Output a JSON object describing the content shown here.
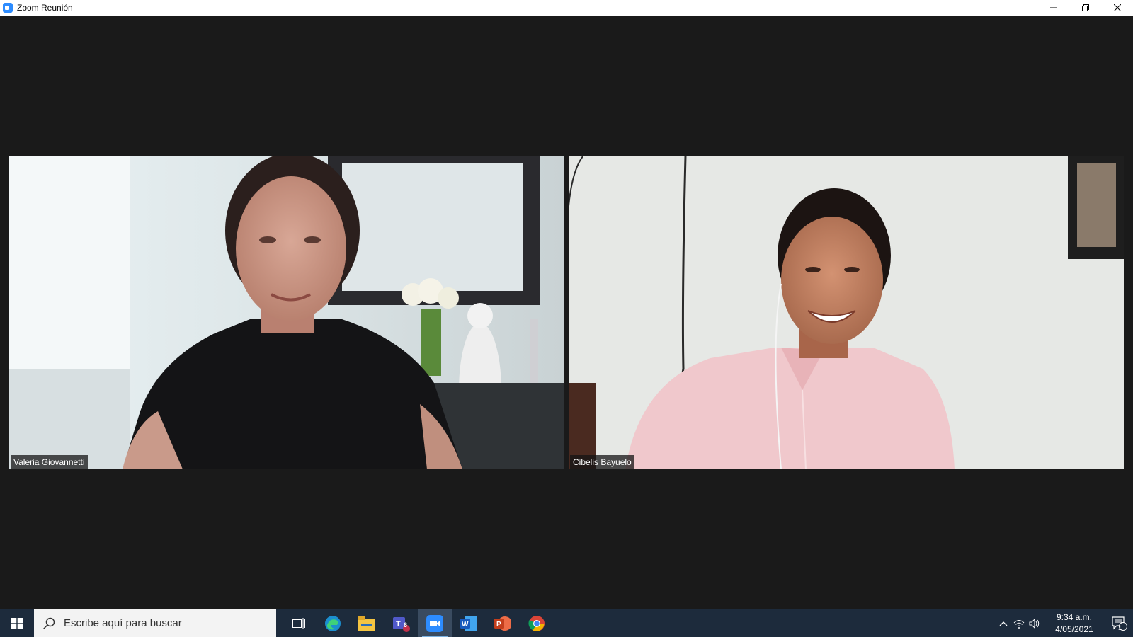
{
  "window": {
    "title": "Zoom Reunión",
    "controls": [
      "minimize-icon",
      "restore-icon",
      "close-icon"
    ]
  },
  "participants": [
    {
      "name": "Valeria Giovannetti"
    },
    {
      "name": "Cibelis Bayuelo"
    }
  ],
  "taskbar": {
    "search_placeholder": "Escribe aquí para buscar",
    "apps": [
      {
        "icon": "task-view-icon"
      },
      {
        "icon": "edge-icon"
      },
      {
        "icon": "file-explorer-icon"
      },
      {
        "icon": "teams-icon",
        "badge": "6"
      },
      {
        "icon": "zoom-icon",
        "active": true
      },
      {
        "icon": "word-icon"
      },
      {
        "icon": "powerpoint-icon"
      },
      {
        "icon": "chrome-icon"
      }
    ],
    "time": "9:34 a.m.",
    "date": "4/05/2021",
    "notification_count": "1"
  }
}
